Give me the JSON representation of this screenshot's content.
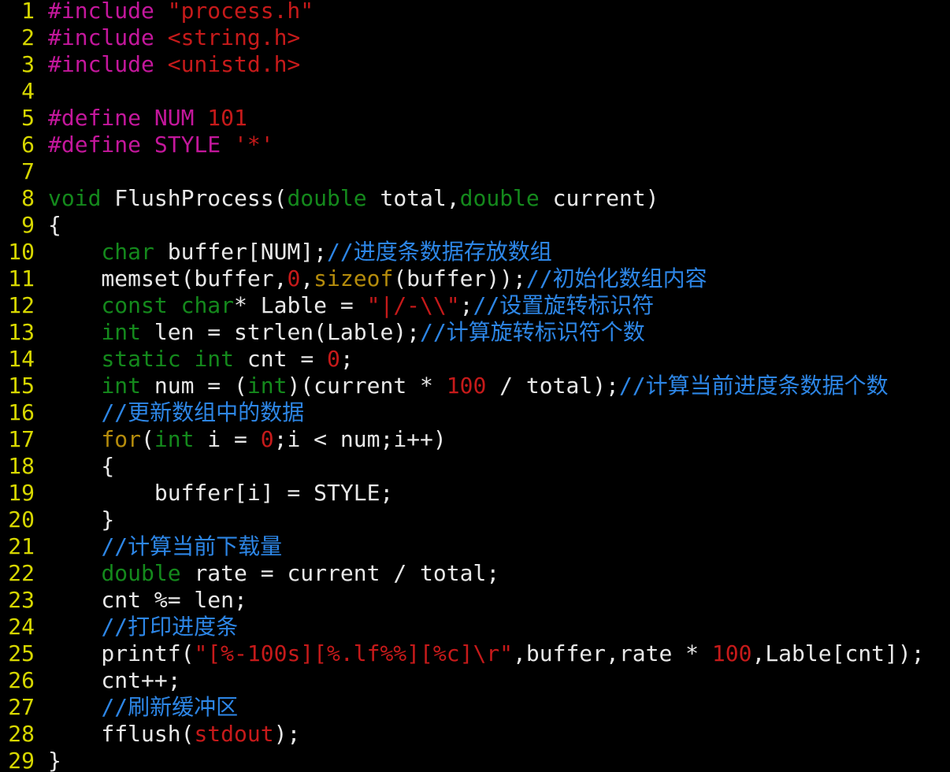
{
  "editor": {
    "lines": [
      {
        "n": "1",
        "tokens": [
          {
            "t": "#include ",
            "c": "preproc"
          },
          {
            "t": "\"process.h\"",
            "c": "string"
          }
        ]
      },
      {
        "n": "2",
        "tokens": [
          {
            "t": "#include ",
            "c": "preproc"
          },
          {
            "t": "<string.h>",
            "c": "string"
          }
        ]
      },
      {
        "n": "3",
        "tokens": [
          {
            "t": "#include ",
            "c": "preproc"
          },
          {
            "t": "<unistd.h>",
            "c": "string"
          }
        ]
      },
      {
        "n": "4",
        "tokens": []
      },
      {
        "n": "5",
        "tokens": [
          {
            "t": "#define ",
            "c": "preproc"
          },
          {
            "t": "NUM ",
            "c": "preproc"
          },
          {
            "t": "101",
            "c": "number"
          }
        ]
      },
      {
        "n": "6",
        "tokens": [
          {
            "t": "#define ",
            "c": "preproc"
          },
          {
            "t": "STYLE ",
            "c": "preproc"
          },
          {
            "t": "'*'",
            "c": "string"
          }
        ]
      },
      {
        "n": "7",
        "tokens": []
      },
      {
        "n": "8",
        "tokens": [
          {
            "t": "void",
            "c": "type"
          },
          {
            "t": " FlushProcess(",
            "c": "normal"
          },
          {
            "t": "double",
            "c": "type"
          },
          {
            "t": " total,",
            "c": "normal"
          },
          {
            "t": "double",
            "c": "type"
          },
          {
            "t": " current)",
            "c": "normal"
          }
        ]
      },
      {
        "n": "9",
        "tokens": [
          {
            "t": "{",
            "c": "normal"
          }
        ]
      },
      {
        "n": "10",
        "tokens": [
          {
            "t": "    ",
            "c": "normal"
          },
          {
            "t": "char",
            "c": "type"
          },
          {
            "t": " buffer[NUM];",
            "c": "normal"
          },
          {
            "t": "//进度条数据存放数组",
            "c": "comment"
          }
        ]
      },
      {
        "n": "11",
        "tokens": [
          {
            "t": "    memset(buffer,",
            "c": "normal"
          },
          {
            "t": "0",
            "c": "number"
          },
          {
            "t": ",",
            "c": "normal"
          },
          {
            "t": "sizeof",
            "c": "keyword"
          },
          {
            "t": "(buffer));",
            "c": "normal"
          },
          {
            "t": "//初始化数组内容",
            "c": "comment"
          }
        ]
      },
      {
        "n": "12",
        "tokens": [
          {
            "t": "    ",
            "c": "normal"
          },
          {
            "t": "const",
            "c": "type"
          },
          {
            "t": " ",
            "c": "normal"
          },
          {
            "t": "char",
            "c": "type"
          },
          {
            "t": "* Lable = ",
            "c": "normal"
          },
          {
            "t": "\"|/-\\\\\"",
            "c": "string"
          },
          {
            "t": ";",
            "c": "normal"
          },
          {
            "t": "//设置旋转标识符",
            "c": "comment"
          }
        ]
      },
      {
        "n": "13",
        "tokens": [
          {
            "t": "    ",
            "c": "normal"
          },
          {
            "t": "int",
            "c": "type"
          },
          {
            "t": " len = strlen(Lable);",
            "c": "normal"
          },
          {
            "t": "//计算旋转标识符个数",
            "c": "comment"
          }
        ]
      },
      {
        "n": "14",
        "tokens": [
          {
            "t": "    ",
            "c": "normal"
          },
          {
            "t": "static",
            "c": "type"
          },
          {
            "t": " ",
            "c": "normal"
          },
          {
            "t": "int",
            "c": "type"
          },
          {
            "t": " cnt = ",
            "c": "normal"
          },
          {
            "t": "0",
            "c": "number"
          },
          {
            "t": ";",
            "c": "normal"
          }
        ]
      },
      {
        "n": "15",
        "tokens": [
          {
            "t": "    ",
            "c": "normal"
          },
          {
            "t": "int",
            "c": "type"
          },
          {
            "t": " num = (",
            "c": "normal"
          },
          {
            "t": "int",
            "c": "type"
          },
          {
            "t": ")(current * ",
            "c": "normal"
          },
          {
            "t": "100",
            "c": "number"
          },
          {
            "t": " / total);",
            "c": "normal"
          },
          {
            "t": "//计算当前进度条数据个数",
            "c": "comment"
          }
        ]
      },
      {
        "n": "16",
        "tokens": [
          {
            "t": "    ",
            "c": "normal"
          },
          {
            "t": "//更新数组中的数据",
            "c": "comment"
          }
        ]
      },
      {
        "n": "17",
        "tokens": [
          {
            "t": "    ",
            "c": "normal"
          },
          {
            "t": "for",
            "c": "keyword"
          },
          {
            "t": "(",
            "c": "normal"
          },
          {
            "t": "int",
            "c": "type"
          },
          {
            "t": " i = ",
            "c": "normal"
          },
          {
            "t": "0",
            "c": "number"
          },
          {
            "t": ";i < num;i++)",
            "c": "normal"
          }
        ]
      },
      {
        "n": "18",
        "tokens": [
          {
            "t": "    {",
            "c": "normal"
          }
        ]
      },
      {
        "n": "19",
        "tokens": [
          {
            "t": "        buffer[i] = STYLE;",
            "c": "normal"
          }
        ]
      },
      {
        "n": "20",
        "tokens": [
          {
            "t": "    }",
            "c": "normal"
          }
        ]
      },
      {
        "n": "21",
        "tokens": [
          {
            "t": "    ",
            "c": "normal"
          },
          {
            "t": "//计算当前下载量",
            "c": "comment"
          }
        ]
      },
      {
        "n": "22",
        "tokens": [
          {
            "t": "    ",
            "c": "normal"
          },
          {
            "t": "double",
            "c": "type"
          },
          {
            "t": " rate = current / total;",
            "c": "normal"
          }
        ]
      },
      {
        "n": "23",
        "tokens": [
          {
            "t": "    cnt %= len;",
            "c": "normal"
          }
        ]
      },
      {
        "n": "24",
        "tokens": [
          {
            "t": "    ",
            "c": "normal"
          },
          {
            "t": "//打印进度条",
            "c": "comment"
          }
        ]
      },
      {
        "n": "25",
        "tokens": [
          {
            "t": "    printf(",
            "c": "normal"
          },
          {
            "t": "\"[%-100s][%.lf%%][%c]\\r\"",
            "c": "string"
          },
          {
            "t": ",buffer,rate * ",
            "c": "normal"
          },
          {
            "t": "100",
            "c": "number"
          },
          {
            "t": ",Lable[cnt]);",
            "c": "normal"
          }
        ]
      },
      {
        "n": "26",
        "tokens": [
          {
            "t": "    cnt++;",
            "c": "normal"
          }
        ]
      },
      {
        "n": "27",
        "tokens": [
          {
            "t": "    ",
            "c": "normal"
          },
          {
            "t": "//刷新缓冲区",
            "c": "comment"
          }
        ]
      },
      {
        "n": "28",
        "tokens": [
          {
            "t": "    fflush(",
            "c": "normal"
          },
          {
            "t": "stdout",
            "c": "string"
          },
          {
            "t": ");",
            "c": "normal"
          }
        ]
      },
      {
        "n": "29",
        "tokens": [
          {
            "t": "}",
            "c": "normal"
          }
        ]
      }
    ]
  },
  "colors": {
    "background": "#000000",
    "line_number": "#d7d700",
    "normal_text": "#e8e8e8",
    "preprocessor": "#c4179c",
    "string_literal": "#c61a1a",
    "type_keyword": "#14891c",
    "comment": "#2d86e6",
    "control_keyword": "#b58c0c"
  }
}
